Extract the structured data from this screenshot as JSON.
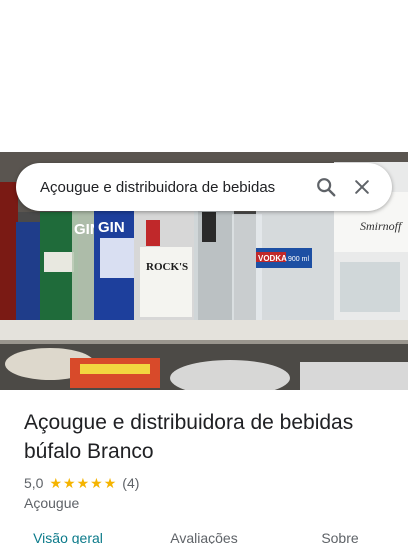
{
  "search": {
    "query": "Açougue e distribuidora de bebidas"
  },
  "place": {
    "title": "Açougue e distribuidora de bebidas búfalo Branco",
    "rating": "5,0",
    "stars_value": 5,
    "review_count": "(4)",
    "category": "Açougue"
  },
  "tabs": [
    {
      "label": "Visão geral",
      "active": true
    },
    {
      "label": "Avaliações",
      "active": false
    },
    {
      "label": "Sobre",
      "active": false
    }
  ],
  "photo_labels": {
    "gin_left": "GIN",
    "gin_right": "GIN",
    "rocks": "ROCK'S",
    "vodka": "VODKA",
    "vodka_volume": "900 ml",
    "smirnoff": "Smirnoff"
  },
  "colors": {
    "star": "#f5b400",
    "active_tab": "#0b7a8a",
    "text_primary": "#202124",
    "text_secondary": "#5f6368"
  }
}
